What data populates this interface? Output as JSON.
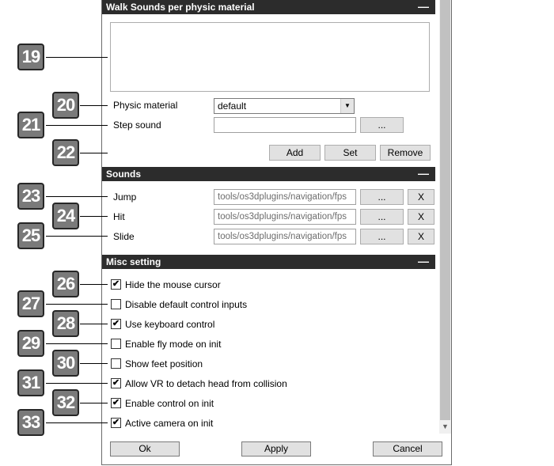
{
  "sections": {
    "walk_sounds": {
      "title": "Walk Sounds per physic material",
      "collapse": "—"
    },
    "sounds": {
      "title": "Sounds",
      "collapse": "—"
    },
    "misc": {
      "title": "Misc setting",
      "collapse": "—"
    }
  },
  "walk": {
    "physic_material_label": "Physic material",
    "physic_material_value": "default",
    "step_sound_label": "Step sound",
    "step_sound_value": "",
    "browse": "...",
    "add": "Add",
    "set": "Set",
    "remove": "Remove"
  },
  "sounds": {
    "rows": [
      {
        "label": "Jump",
        "value": "tools/os3dplugins/navigation/fps",
        "browse": "...",
        "clear": "X"
      },
      {
        "label": "Hit",
        "value": "tools/os3dplugins/navigation/fps",
        "browse": "...",
        "clear": "X"
      },
      {
        "label": "Slide",
        "value": "tools/os3dplugins/navigation/fps",
        "browse": "...",
        "clear": "X"
      }
    ]
  },
  "misc": {
    "options": [
      {
        "label": "Hide the mouse cursor",
        "checked": true
      },
      {
        "label": "Disable default control inputs",
        "checked": false
      },
      {
        "label": "Use keyboard control",
        "checked": true
      },
      {
        "label": "Enable fly mode on init",
        "checked": false
      },
      {
        "label": "Show feet position",
        "checked": false
      },
      {
        "label": "Allow VR to detach head from collision",
        "checked": true
      },
      {
        "label": "Enable control on init",
        "checked": true
      },
      {
        "label": "Active camera on init",
        "checked": true
      }
    ]
  },
  "footer": {
    "ok": "Ok",
    "apply": "Apply",
    "cancel": "Cancel"
  },
  "callouts": [
    "19",
    "20",
    "21",
    "22",
    "23",
    "24",
    "25",
    "26",
    "27",
    "28",
    "29",
    "30",
    "31",
    "32",
    "33"
  ],
  "icons": {
    "dropdown": "chevron-down-icon",
    "check": "✔",
    "scroll_down": "▼"
  }
}
